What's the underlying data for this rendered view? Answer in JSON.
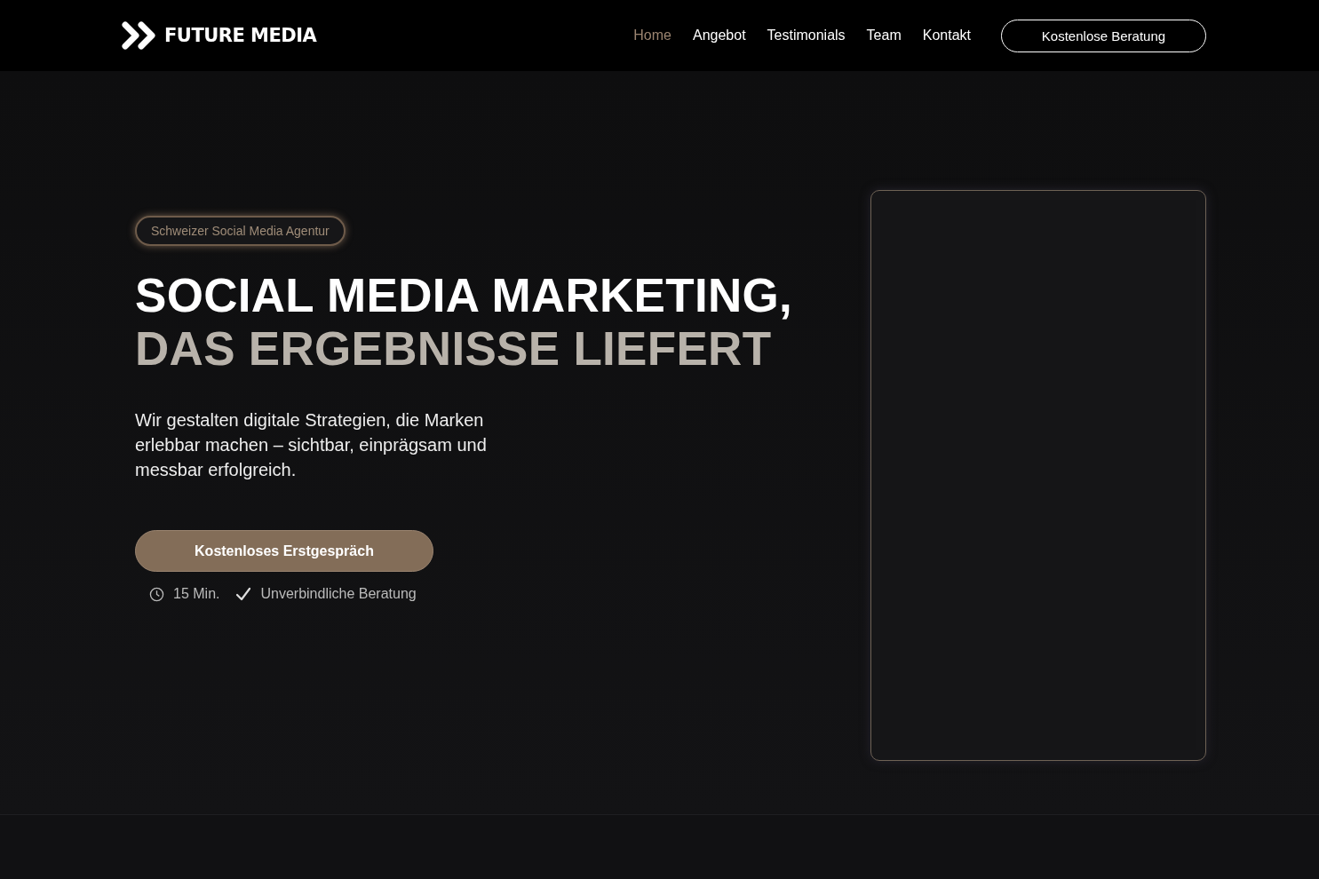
{
  "header": {
    "logo": "FUTURE MEDIA",
    "nav": [
      {
        "label": "Home",
        "selected": true
      },
      {
        "label": "Angebot",
        "selected": false
      },
      {
        "label": "Testimonials",
        "selected": false
      },
      {
        "label": "Team",
        "selected": false
      },
      {
        "label": "Kontakt",
        "selected": false
      }
    ],
    "cta": "Kostenlose Beratung"
  },
  "hero": {
    "badge": "Schweizer Social Media Agentur",
    "title_line_1": "SOCIAL MEDIA MARKETING,",
    "title_line_2": "DAS ERGEBNISSE LIEFERT",
    "text": "Wir gestalten digitale Strategien, die Marken erlebbar machen – sichtbar, einprägsam und messbar erfolgreich.",
    "button": "Kostenloses Erstgespräch",
    "facts": [
      {
        "kind": "clock",
        "text": "15 Min."
      },
      {
        "kind": "check",
        "text": "Unverbindliche Beratung"
      }
    ]
  }
}
